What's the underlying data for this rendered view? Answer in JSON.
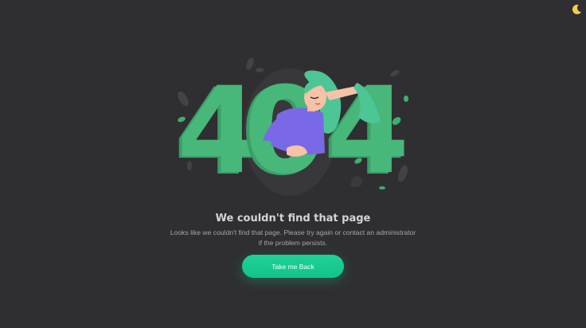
{
  "illustration": {
    "digits": [
      "4",
      "0",
      "4"
    ]
  },
  "message": {
    "title": "We couldn't find that page",
    "line1": "Looks like we couldn't find that page. Please try again or contact an administrator",
    "line2": "if the problem persists."
  },
  "actions": {
    "back_label": "Take me Back"
  },
  "icons": {
    "theme_toggle": "moon-icon"
  },
  "colors": {
    "background": "#2f2f31",
    "accent": "#1fd19a",
    "digit_green": "#3fae72",
    "moon": "#f3d04a"
  }
}
